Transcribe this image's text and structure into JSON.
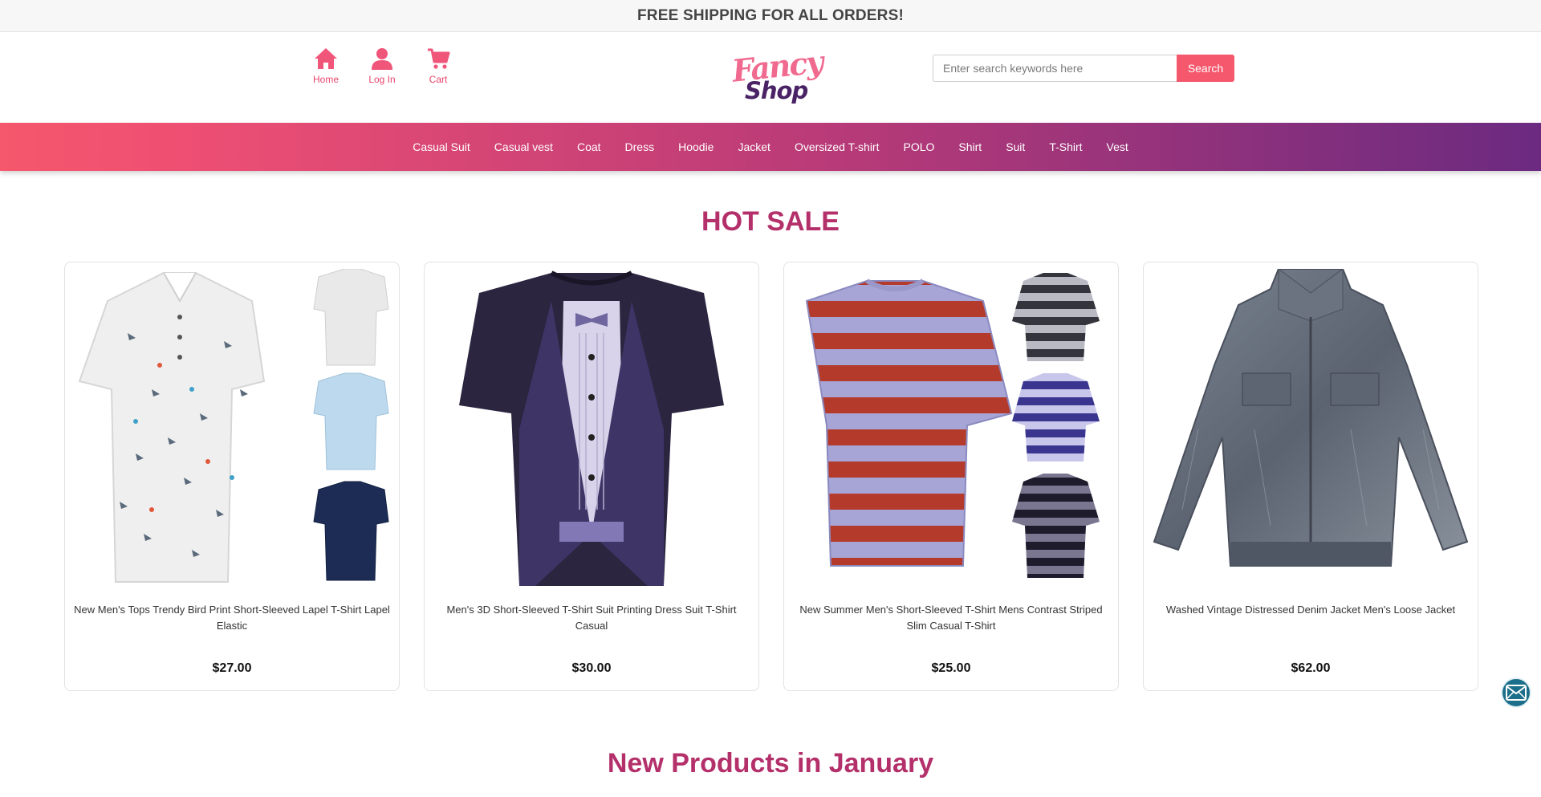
{
  "announcement": "FREE SHIPPING FOR ALL ORDERS!",
  "nav": {
    "home": "Home",
    "login": "Log In",
    "cart": "Cart",
    "icons": [
      "home-icon",
      "user-icon",
      "cart-icon"
    ]
  },
  "logo": {
    "line1": "Fancy",
    "line2": "Shop"
  },
  "search": {
    "placeholder": "Enter search keywords here",
    "value": "",
    "button": "Search"
  },
  "categories": [
    "Casual Suit",
    "Casual vest",
    "Coat",
    "Dress",
    "Hoodie",
    "Jacket",
    "Oversized T-shirt",
    "POLO",
    "Shirt",
    "Suit",
    "T-Shirt",
    "Vest"
  ],
  "hot_sale": {
    "title": "HOT SALE",
    "products": [
      {
        "name": "New Men's Tops Trendy Bird Print Short-Sleeved Lapel T-Shirt Lapel Elastic",
        "price": "$27.00"
      },
      {
        "name": "Men's 3D Short-Sleeved T-Shirt Suit Printing Dress Suit T-Shirt Casual",
        "price": "$30.00"
      },
      {
        "name": "New Summer Men's Short-Sleeved T-Shirt Mens Contrast Striped Slim Casual T-Shirt",
        "price": "$25.00"
      },
      {
        "name": "Washed Vintage Distressed Denim Jacket Men's Loose Jacket",
        "price": "$62.00"
      }
    ]
  },
  "new_products": {
    "title": "New Products in January"
  },
  "colors": {
    "accent": "#f5576c",
    "title": "#b4306a",
    "gradient_end": "#6b2a80",
    "mail": "#1c6f8a"
  }
}
